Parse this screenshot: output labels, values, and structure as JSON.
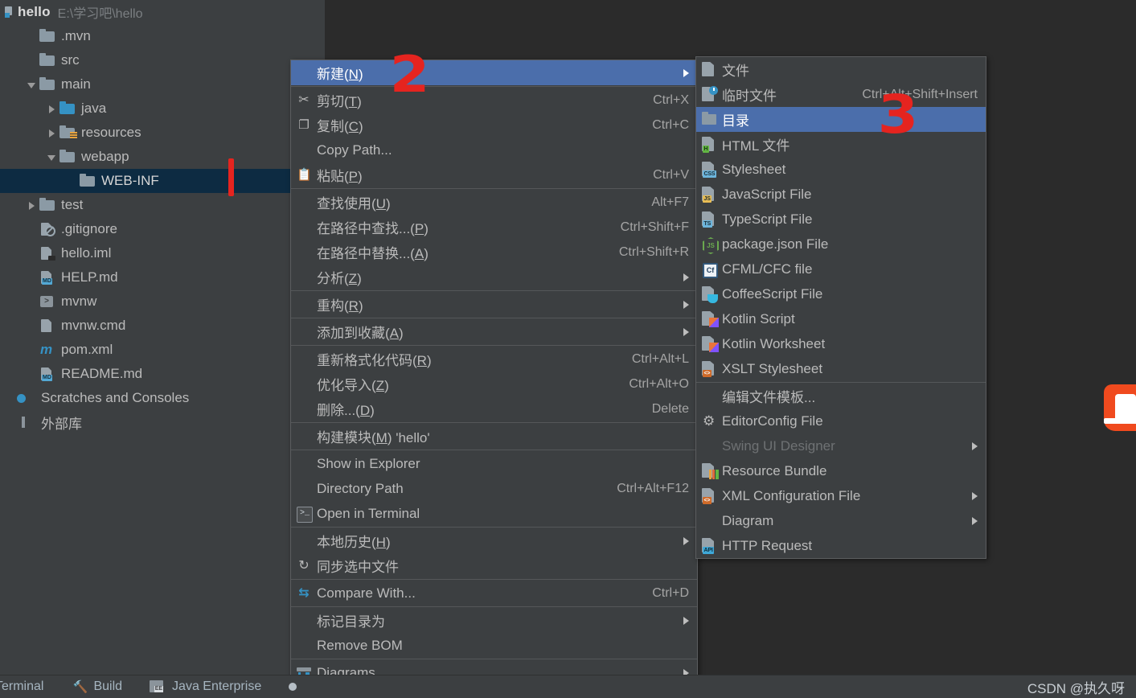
{
  "window": {
    "project_name": "hello",
    "project_path": "E:\\学习吧\\hello"
  },
  "sidebar": {
    "items": [
      {
        "label": ".mvn",
        "icon": "folder-icon",
        "indent": 1,
        "arrow": "none"
      },
      {
        "label": "src",
        "icon": "folder-icon",
        "indent": 1,
        "arrow": "none"
      },
      {
        "label": "main",
        "icon": "folder-icon",
        "indent": 1,
        "arrow": "open"
      },
      {
        "label": "java",
        "icon": "folder-source-icon",
        "indent": 2,
        "arrow": "closed"
      },
      {
        "label": "resources",
        "icon": "folder-resources-icon",
        "indent": 2,
        "arrow": "closed"
      },
      {
        "label": "webapp",
        "icon": "folder-icon",
        "indent": 2,
        "arrow": "open"
      },
      {
        "label": "WEB-INF",
        "icon": "folder-icon",
        "indent": 3,
        "arrow": "none",
        "selected": true
      },
      {
        "label": "test",
        "icon": "folder-icon",
        "indent": 1,
        "arrow": "closed"
      },
      {
        "label": ".gitignore",
        "icon": "gitignore-file-icon",
        "indent": 1,
        "arrow": "none"
      },
      {
        "label": "hello.iml",
        "icon": "iml-file-icon",
        "indent": 1,
        "arrow": "none"
      },
      {
        "label": "HELP.md",
        "icon": "markdown-file-icon",
        "indent": 1,
        "arrow": "none"
      },
      {
        "label": "mvnw",
        "icon": "shell-script-icon",
        "indent": 1,
        "arrow": "none"
      },
      {
        "label": "mvnw.cmd",
        "icon": "cmd-file-icon",
        "indent": 1,
        "arrow": "none"
      },
      {
        "label": "pom.xml",
        "icon": "maven-file-icon",
        "indent": 1,
        "arrow": "none"
      },
      {
        "label": "README.md",
        "icon": "markdown-file-icon",
        "indent": 1,
        "arrow": "none"
      },
      {
        "label": "Scratches and Consoles",
        "icon": "scratches-icon",
        "indent": 0,
        "arrow": "none"
      },
      {
        "label": "外部库",
        "icon": "external-libraries-icon",
        "indent": 0,
        "arrow": "none"
      }
    ]
  },
  "context_menu": {
    "items": [
      {
        "label": "新建(N)",
        "mnemonic": "N",
        "shortcut": "",
        "icon": "",
        "submenu": true,
        "highlighted": true
      },
      {
        "sep": true
      },
      {
        "label": "剪切(T)",
        "mnemonic": "T",
        "shortcut": "Ctrl+X",
        "icon": "scissors-icon"
      },
      {
        "label": "复制(C)",
        "mnemonic": "C",
        "shortcut": "Ctrl+C",
        "icon": "copy-icon"
      },
      {
        "label": "Copy Path...",
        "shortcut": "",
        "icon": ""
      },
      {
        "label": "粘贴(P)",
        "mnemonic": "P",
        "shortcut": "Ctrl+V",
        "icon": "paste-icon"
      },
      {
        "sep": true
      },
      {
        "label": "查找使用(U)",
        "mnemonic": "U",
        "shortcut": "Alt+F7",
        "icon": ""
      },
      {
        "label": "在路径中查找...(P)",
        "mnemonic": "P",
        "shortcut": "Ctrl+Shift+F",
        "icon": ""
      },
      {
        "label": "在路径中替换...(A)",
        "mnemonic": "A",
        "shortcut": "Ctrl+Shift+R",
        "icon": ""
      },
      {
        "label": "分析(Z)",
        "mnemonic": "Z",
        "shortcut": "",
        "icon": "",
        "submenu": true
      },
      {
        "sep": true
      },
      {
        "label": "重构(R)",
        "mnemonic": "R",
        "shortcut": "",
        "icon": "",
        "submenu": true
      },
      {
        "sep": true
      },
      {
        "label": "添加到收藏(A)",
        "mnemonic": "A",
        "shortcut": "",
        "icon": "",
        "submenu": true
      },
      {
        "sep": true
      },
      {
        "label": "重新格式化代码(R)",
        "mnemonic": "R",
        "shortcut": "Ctrl+Alt+L",
        "icon": ""
      },
      {
        "label": "优化导入(Z)",
        "mnemonic": "Z",
        "shortcut": "Ctrl+Alt+O",
        "icon": ""
      },
      {
        "label": "删除...(D)",
        "mnemonic": "D",
        "shortcut": "Delete",
        "icon": ""
      },
      {
        "sep": true
      },
      {
        "label": "构建模块(M) 'hello'",
        "mnemonic": "M",
        "shortcut": "",
        "icon": ""
      },
      {
        "sep": true
      },
      {
        "label": "Show in Explorer",
        "shortcut": "",
        "icon": ""
      },
      {
        "label": "Directory Path",
        "mnemonic": "P",
        "shortcut": "Ctrl+Alt+F12",
        "icon": ""
      },
      {
        "label": "Open in Terminal",
        "shortcut": "",
        "icon": "terminal-icon"
      },
      {
        "sep": true
      },
      {
        "label": "本地历史(H)",
        "mnemonic": "H",
        "shortcut": "",
        "icon": "",
        "submenu": true
      },
      {
        "label": "同步选中文件",
        "shortcut": "",
        "icon": "sync-icon"
      },
      {
        "sep": true
      },
      {
        "label": "Compare With...",
        "shortcut": "Ctrl+D",
        "icon": "compare-icon"
      },
      {
        "sep": true
      },
      {
        "label": "标记目录为",
        "shortcut": "",
        "icon": "",
        "submenu": true
      },
      {
        "label": "Remove BOM",
        "shortcut": "",
        "icon": ""
      },
      {
        "sep": true
      },
      {
        "label": "Diagrams",
        "shortcut": "",
        "icon": "diagrams-icon",
        "submenu": true
      }
    ]
  },
  "new_submenu": {
    "items": [
      {
        "label": "文件",
        "shortcut": "",
        "icon": "file-icon"
      },
      {
        "label": "临时文件",
        "shortcut": "Ctrl+Alt+Shift+Insert",
        "icon": "scratch-file-icon"
      },
      {
        "label": "目录",
        "shortcut": "",
        "icon": "directory-icon",
        "highlighted": true
      },
      {
        "label": "HTML 文件",
        "shortcut": "",
        "icon": "html-file-icon"
      },
      {
        "label": "Stylesheet",
        "shortcut": "",
        "icon": "css-file-icon"
      },
      {
        "label": "JavaScript File",
        "shortcut": "",
        "icon": "javascript-file-icon"
      },
      {
        "label": "TypeScript File",
        "shortcut": "",
        "icon": "typescript-file-icon"
      },
      {
        "label": "package.json File",
        "shortcut": "",
        "icon": "nodejs-file-icon"
      },
      {
        "label": "CFML/CFC file",
        "shortcut": "",
        "icon": "cfml-file-icon"
      },
      {
        "label": "CoffeeScript File",
        "shortcut": "",
        "icon": "coffeescript-file-icon"
      },
      {
        "label": "Kotlin Script",
        "shortcut": "",
        "icon": "kotlin-file-icon"
      },
      {
        "label": "Kotlin Worksheet",
        "shortcut": "",
        "icon": "kotlin-file-icon"
      },
      {
        "label": "XSLT Stylesheet",
        "shortcut": "",
        "icon": "xslt-file-icon"
      },
      {
        "sep": true
      },
      {
        "label": "编辑文件模板...",
        "shortcut": "",
        "icon": ""
      },
      {
        "label": "EditorConfig File",
        "shortcut": "",
        "icon": "gear-icon"
      },
      {
        "label": "Swing UI Designer",
        "shortcut": "",
        "icon": "",
        "submenu": true,
        "disabled": true
      },
      {
        "label": "Resource Bundle",
        "shortcut": "",
        "icon": "resource-bundle-icon"
      },
      {
        "label": "XML Configuration File",
        "shortcut": "",
        "icon": "xml-file-icon",
        "submenu": true
      },
      {
        "label": "Diagram",
        "shortcut": "",
        "icon": "",
        "submenu": true
      },
      {
        "label": "HTTP Request",
        "shortcut": "",
        "icon": "http-request-icon"
      }
    ]
  },
  "annotations": [
    {
      "label": "1",
      "kind": "stroke-marker",
      "color": "#e5241f"
    },
    {
      "label": "2",
      "kind": "digit",
      "color": "#e5241f"
    },
    {
      "label": "3",
      "kind": "digit",
      "color": "#e5241f"
    }
  ],
  "status_bar": {
    "items": [
      {
        "label": "Terminal",
        "icon": "terminal-icon"
      },
      {
        "label": "Build",
        "icon": "hammer-icon"
      },
      {
        "label": "Java Enterprise",
        "icon": "java-enterprise-icon"
      }
    ],
    "watermark": "CSDN @执久呀"
  },
  "colors": {
    "menu_bg": "#3c3f41",
    "menu_highlight": "#4b6eab",
    "tree_selected": "#0d2b42",
    "editor_bg": "#2b2b2b",
    "text": "#bbbbbb",
    "annotation_red": "#e5241f"
  }
}
